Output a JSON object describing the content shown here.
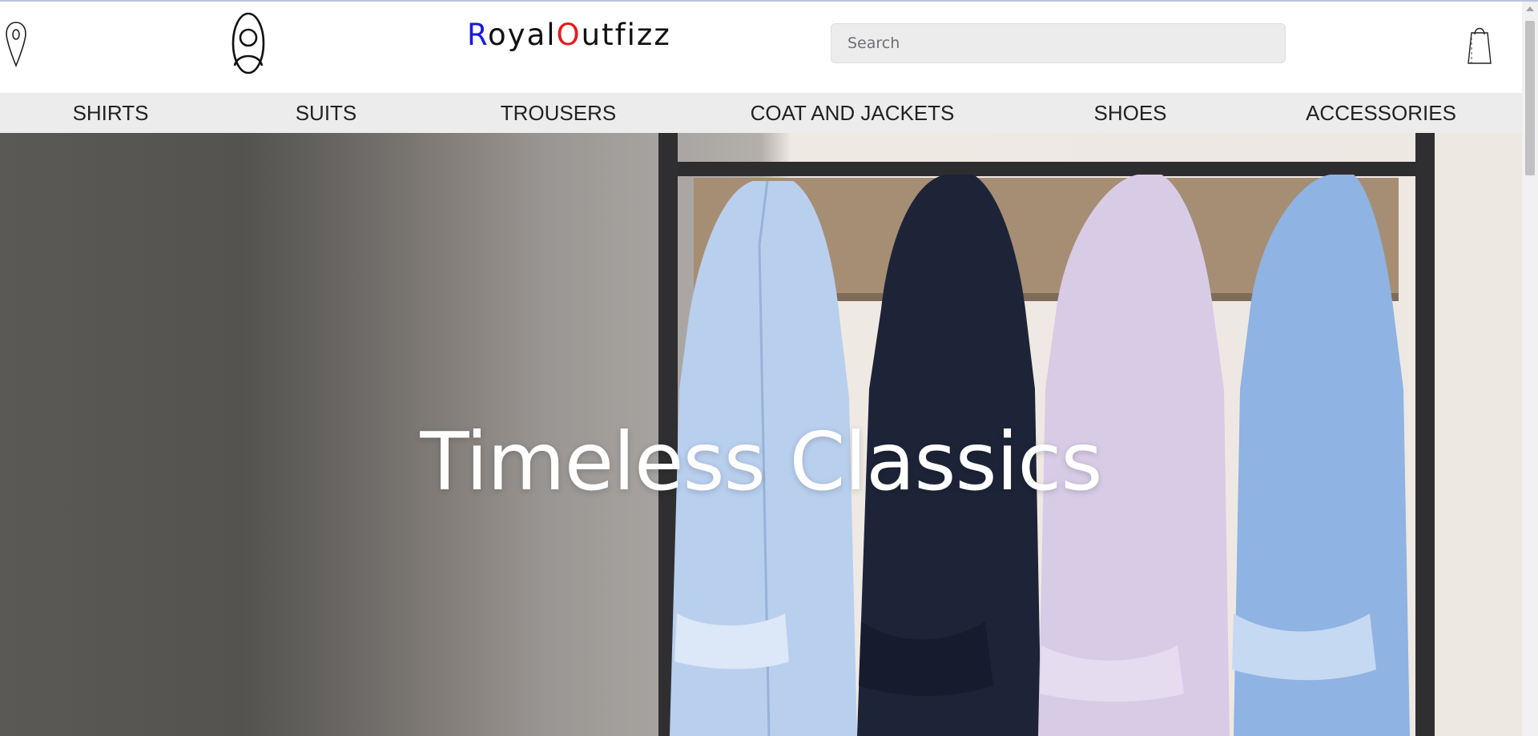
{
  "header": {
    "brand": {
      "first_letter": "R",
      "part1": "oyal",
      "second_letter": "O",
      "part2": "utfizz"
    },
    "search": {
      "placeholder": "Search",
      "value": ""
    },
    "icons": {
      "location": "location-pin-icon",
      "account": "user-icon",
      "cart": "shopping-bag-icon"
    }
  },
  "nav": {
    "items": [
      {
        "label": "SHIRTS"
      },
      {
        "label": "SUITS"
      },
      {
        "label": "TROUSERS"
      },
      {
        "label": "COAT AND JACKETS"
      },
      {
        "label": "SHOES"
      },
      {
        "label": "ACCESSORIES"
      }
    ]
  },
  "hero": {
    "title": "Timeless Classics",
    "image": "shirts-on-coat-rack",
    "colors": {
      "shirt_1": "#b9cfee",
      "shirt_2": "#1d2438",
      "shirt_3": "#d8cbe6",
      "shirt_4": "#8fb3e2"
    }
  },
  "colors": {
    "brand_accent_blue": "#1a1adb",
    "brand_accent_red": "#e41b1b",
    "nav_background": "#ececec",
    "hero_text": "#ffffff"
  }
}
